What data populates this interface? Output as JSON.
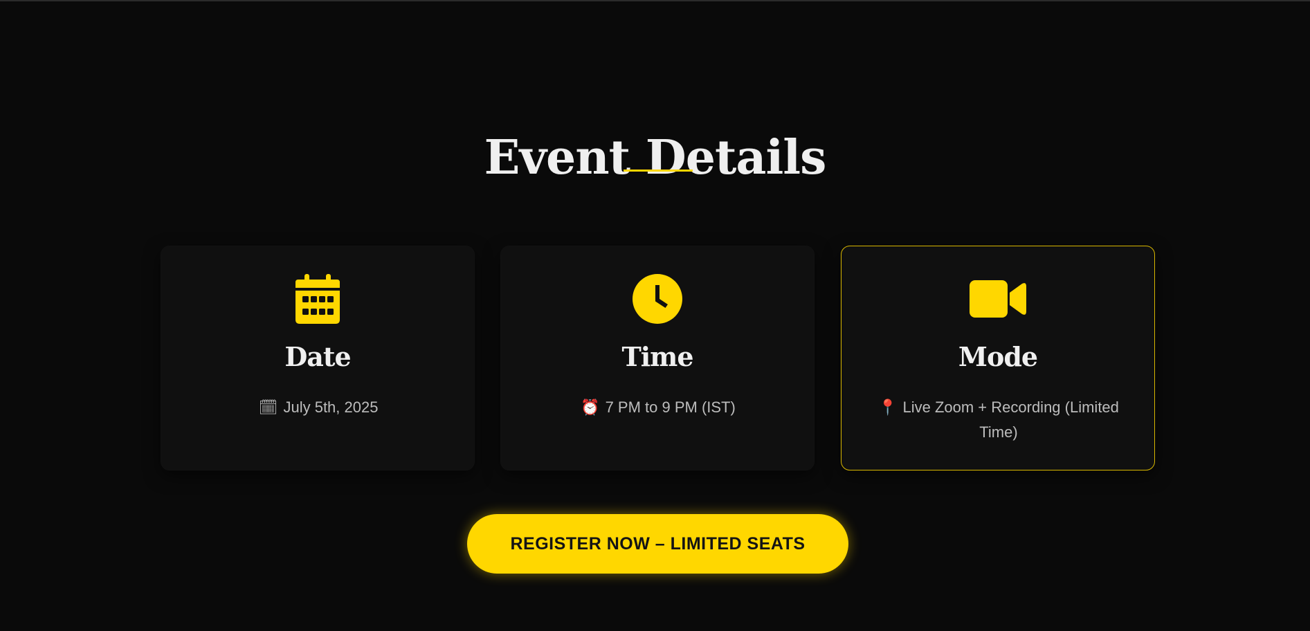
{
  "section": {
    "title": "Event Details"
  },
  "cards": [
    {
      "icon": "calendar-icon",
      "title": "Date",
      "emoji": "🗓",
      "text": "July 5th, 2025",
      "highlighted": false
    },
    {
      "icon": "clock-icon",
      "title": "Time",
      "emoji": "⏰",
      "text": "7 PM to 9 PM (IST)",
      "highlighted": false
    },
    {
      "icon": "video-camera-icon",
      "title": "Mode",
      "emoji": "📍",
      "text": "Live Zoom + Recording (Limited Time)",
      "highlighted": true
    }
  ],
  "cta": {
    "label": "REGISTER NOW – LIMITED SEATS"
  },
  "colors": {
    "background": "#0a0a0a",
    "card_background": "#101010",
    "accent": "#ffd700",
    "heading_text": "#efefef",
    "body_text": "#bdbdbd"
  }
}
